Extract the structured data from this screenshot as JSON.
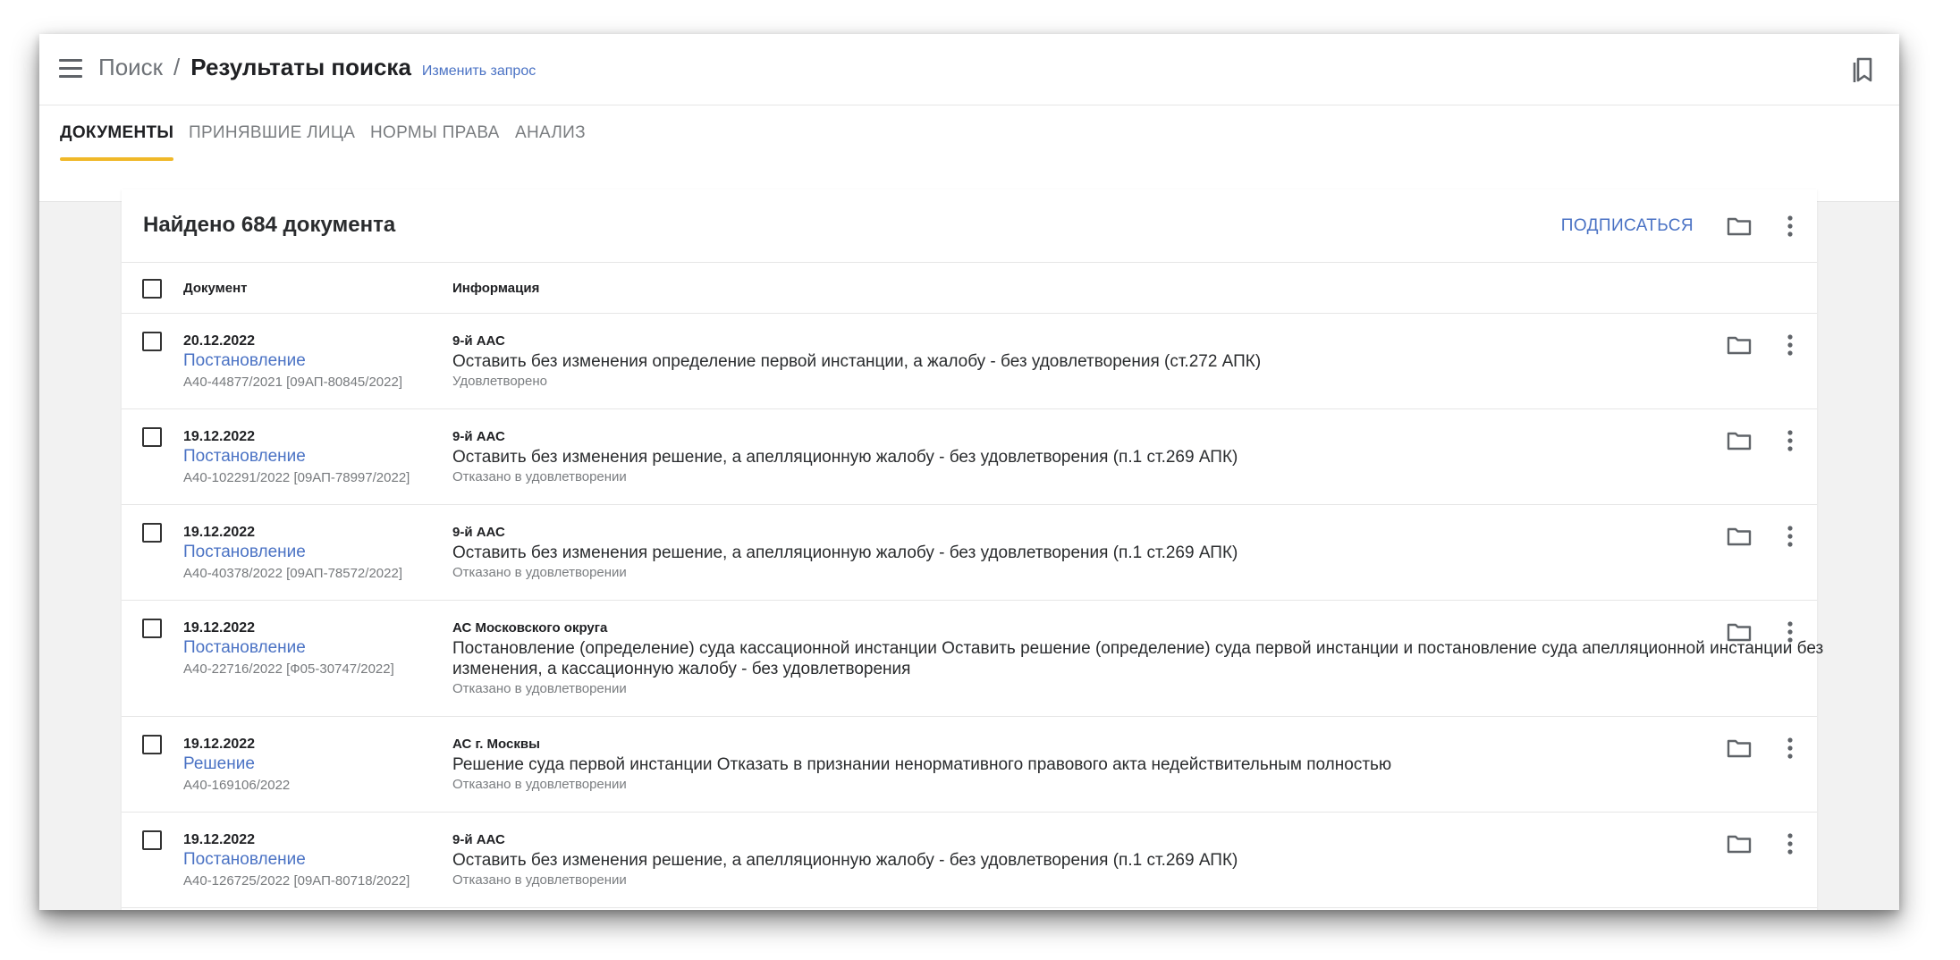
{
  "header": {
    "crumb_search": "Поиск",
    "crumb_separator": "/",
    "title": "Результаты поиска",
    "change_query": "Изменить запрос"
  },
  "tabs": [
    {
      "label": "ДОКУМЕНТЫ",
      "active": true
    },
    {
      "label": "ПРИНЯВШИЕ ЛИЦА",
      "active": false
    },
    {
      "label": "НОРМЫ ПРАВА",
      "active": false
    },
    {
      "label": "АНАЛИЗ",
      "active": false
    }
  ],
  "results": {
    "found_text": "Найдено 684 документа",
    "subscribe_label": "ПОДПИСАТЬСЯ",
    "columns": {
      "document": "Документ",
      "info": "Информация"
    },
    "rows": [
      {
        "date": "20.12.2022",
        "type": "Постановление",
        "number": "А40-44877/2021 [09АП-80845/2022]",
        "court": "9-й ААС",
        "description": "Оставить без изменения определение первой инстанции, а жалобу - без удовлетворения (ст.272 АПК)",
        "status": "Удовлетворено"
      },
      {
        "date": "19.12.2022",
        "type": "Постановление",
        "number": "А40-102291/2022 [09АП-78997/2022]",
        "court": "9-й ААС",
        "description": "Оставить без изменения решение, а апелляционную жалобу - без удовлетворения (п.1 ст.269 АПК)",
        "status": "Отказано в удовлетворении"
      },
      {
        "date": "19.12.2022",
        "type": "Постановление",
        "number": "А40-40378/2022 [09АП-78572/2022]",
        "court": "9-й ААС",
        "description": "Оставить без изменения решение, а апелляционную жалобу - без удовлетворения (п.1 ст.269 АПК)",
        "status": "Отказано в удовлетворении"
      },
      {
        "date": "19.12.2022",
        "type": "Постановление",
        "number": "А40-22716/2022 [Ф05-30747/2022]",
        "court": "АС Московского округа",
        "description": "Постановление (определение) суда кассационной инстанции Оставить решение (определение) суда первой инстанции и постановление суда апелляционной инстанции без изменения, а кассационную жалобу - без удовлетворения",
        "status": "Отказано в удовлетворении"
      },
      {
        "date": "19.12.2022",
        "type": "Решение",
        "number": "А40-169106/2022",
        "court": "АС г. Москвы",
        "description": "Решение суда первой инстанции Отказать в признании ненормативного правового акта недействительным полностью",
        "status": "Отказано в удовлетворении"
      },
      {
        "date": "19.12.2022",
        "type": "Постановление",
        "number": "А40-126725/2022 [09АП-80718/2022]",
        "court": "9-й ААС",
        "description": "Оставить без изменения решение, а апелляционную жалобу - без удовлетворения (п.1 ст.269 АПК)",
        "status": "Отказано в удовлетворении"
      }
    ]
  },
  "colors": {
    "accent": "#f0b828",
    "link": "#4a72c4",
    "icon": "#5f6368"
  },
  "icons": {
    "menu": "hamburger-menu-icon",
    "bookmark": "bookmark-icon",
    "folder": "folder-icon",
    "more": "more-vert-icon"
  }
}
